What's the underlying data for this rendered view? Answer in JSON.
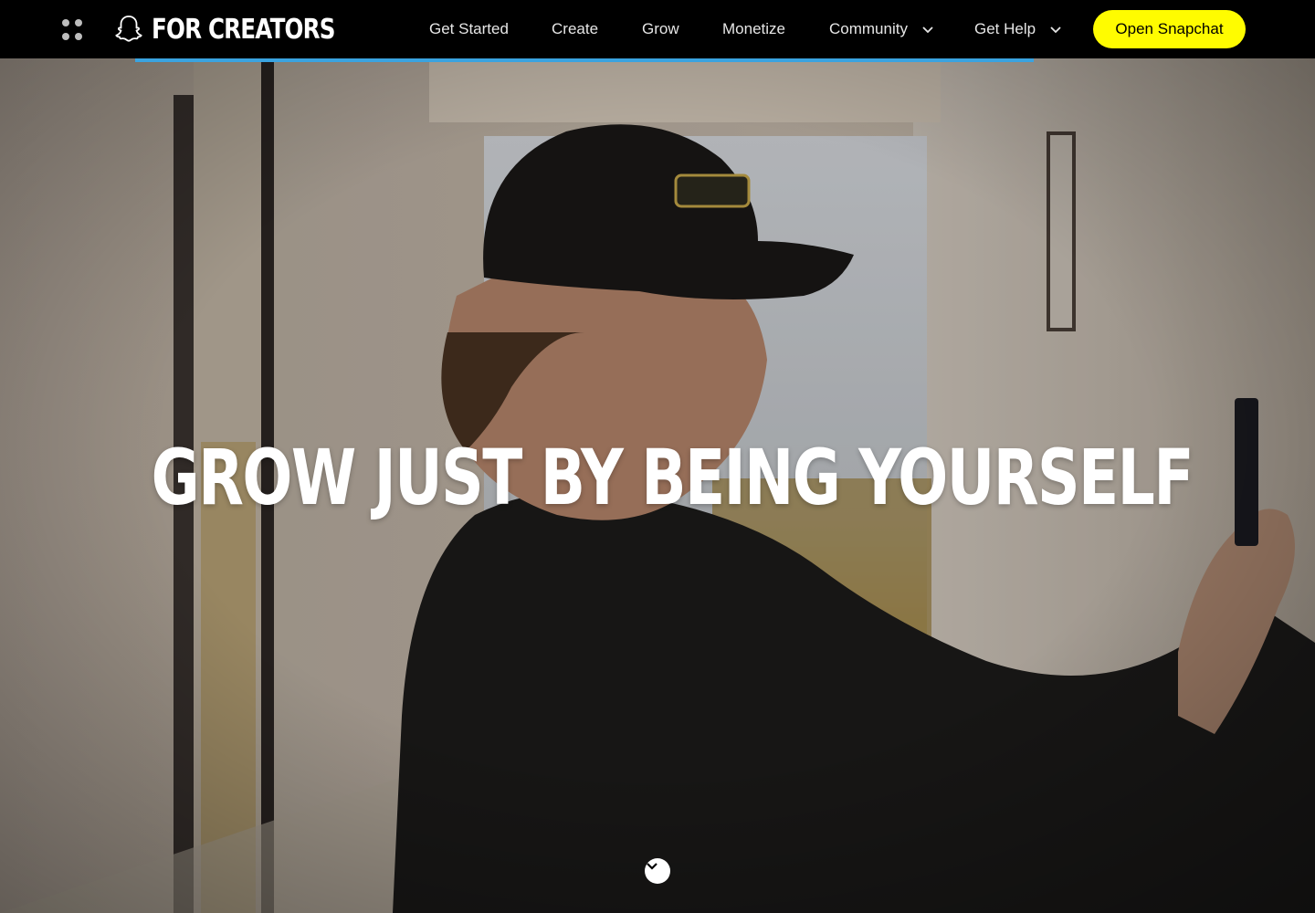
{
  "header": {
    "brand": "FOR CREATORS",
    "nav": [
      {
        "label": "Get Started"
      },
      {
        "label": "Create"
      },
      {
        "label": "Grow"
      },
      {
        "label": "Monetize"
      },
      {
        "label": "Community",
        "has_dropdown": true
      },
      {
        "label": "Get Help",
        "has_dropdown": true
      }
    ],
    "cta_label": "Open Snapchat",
    "icons": {
      "apps": "apps-grid-icon",
      "logo": "snapchat-ghost-icon",
      "dropdown": "chevron-down-icon"
    }
  },
  "hero": {
    "title": "GROW JUST BY BEING YOURSELF",
    "scroll_icon": "chevron-down-icon"
  },
  "colors": {
    "accent": "#fffc00",
    "progress": "#3aa3e0",
    "bar": "#000000"
  }
}
